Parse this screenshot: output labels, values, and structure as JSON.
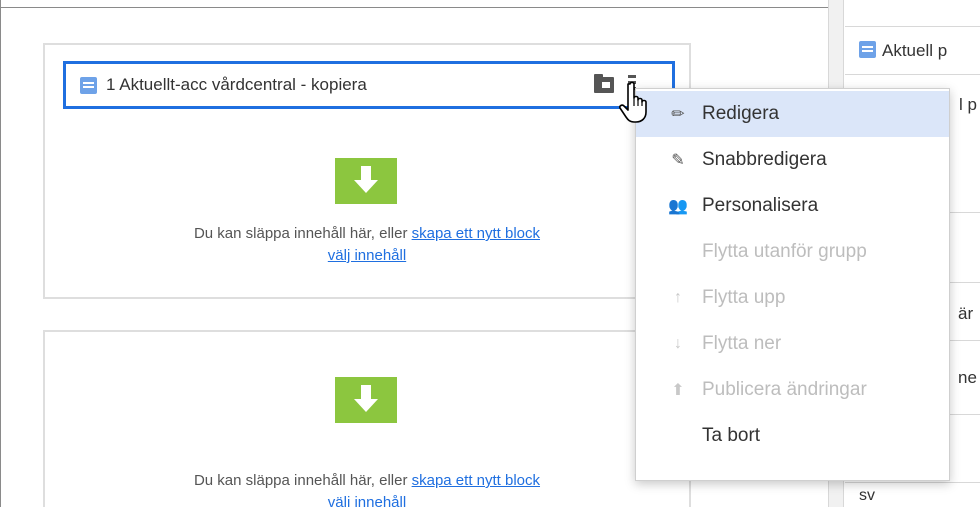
{
  "block": {
    "title": "1 Aktuellt-acc vårdcentral - kopiera",
    "icon": "block-icon"
  },
  "drop_zone": {
    "text_prefix": "Du kan släppa innehåll här, eller ",
    "create_link": "skapa ett nytt block",
    "select_link": "välj innehåll"
  },
  "right_panel": {
    "row1": "Aktuell p",
    "row2": "l p",
    "row3": "är",
    "row4": "ne",
    "row5": "sv"
  },
  "context_menu": {
    "items": [
      {
        "label": "Redigera",
        "icon": "pencil-icon",
        "glyph": "✏",
        "enabled": true,
        "highlighted": true
      },
      {
        "label": "Snabbredigera",
        "icon": "quick-edit-icon",
        "glyph": "✎",
        "enabled": true
      },
      {
        "label": "Personalisera",
        "icon": "users-icon",
        "glyph": "👥",
        "enabled": true
      },
      {
        "label": "Flytta utanför grupp",
        "icon": "",
        "glyph": "",
        "enabled": false
      },
      {
        "label": "Flytta upp",
        "icon": "arrow-up-icon",
        "glyph": "↑",
        "enabled": false
      },
      {
        "label": "Flytta ner",
        "icon": "arrow-down-icon",
        "glyph": "↓",
        "enabled": false
      },
      {
        "label": "Publicera ändringar",
        "icon": "publish-icon",
        "glyph": "⬆",
        "enabled": false
      },
      {
        "label": "Ta bort",
        "icon": "",
        "glyph": "",
        "enabled": true
      }
    ]
  },
  "colors": {
    "accent": "#1f6fe0",
    "drop_green": "#8cc63f",
    "highlight": "#dbe6f9"
  }
}
